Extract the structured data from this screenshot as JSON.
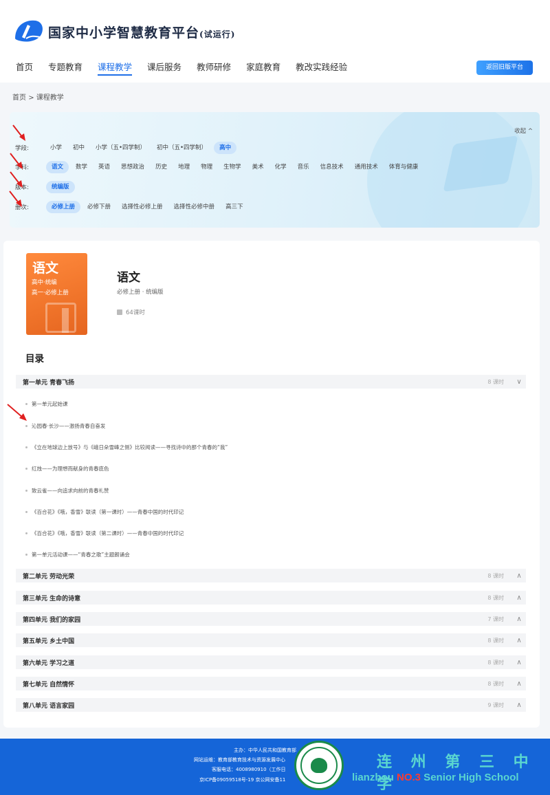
{
  "header": {
    "site_title": "国家中小学智慧教育平台",
    "site_title_suffix": "(试运行)",
    "return_button": "返回旧版平台"
  },
  "nav": {
    "items": [
      "首页",
      "专题教育",
      "课程教学",
      "课后服务",
      "教师研修",
      "家庭教育",
      "教改实践经验"
    ],
    "active": "课程教学"
  },
  "breadcrumb": {
    "home": "首页",
    "sep": ">",
    "current": "课程教学"
  },
  "filter": {
    "collapse": "收起 ^",
    "rows": [
      {
        "label": "学段:",
        "options": [
          "小学",
          "初中",
          "小学（五•四学制）",
          "初中（五•四学制）",
          "高中"
        ],
        "selected": "高中"
      },
      {
        "label": "学科:",
        "options": [
          "语文",
          "数学",
          "英语",
          "思想政治",
          "历史",
          "地理",
          "物理",
          "生物学",
          "美术",
          "化学",
          "音乐",
          "信息技术",
          "通用技术",
          "体育与健康"
        ],
        "selected": "语文"
      },
      {
        "label": "版本:",
        "options": [
          "统编版"
        ],
        "selected": "统编版"
      },
      {
        "label": "册次:",
        "options": [
          "必修上册",
          "必修下册",
          "选择性必修上册",
          "选择性必修中册",
          "高三下"
        ],
        "selected": "必修上册"
      }
    ]
  },
  "book": {
    "cover_title": "语文",
    "cover_line1": "高中·统编",
    "cover_line2": "高一·必修上册",
    "title": "语文",
    "subtitle": "必修上册 · 统编版",
    "hours": "64课时"
  },
  "toc": {
    "title": "目录",
    "first_unit": {
      "title": "第一单元 青春飞扬",
      "hours": "8 课时",
      "icon": "chevron-down"
    },
    "lessons": [
      "第一单元起始课",
      "沁园春·长沙——激扬青春自奋发",
      "《立在地球边上放号》与《峨日朵雪峰之侧》比较阅读——寻找诗中的那个青春的“我”",
      "红烛——为理想而献身的青春底色",
      "致云雀——向追求向前的青春礼赞",
      "《百合花》《哦，香雪》联读（第一课时）——青春中国的时代印记",
      "《百合花》《哦，香雪》联读（第二课时）——青春中国的时代印记",
      "第一单元活动课——“青春之歌”主题朗诵会"
    ],
    "units": [
      {
        "title": "第二单元 劳动光荣",
        "hours": "8 课时"
      },
      {
        "title": "第三单元 生命的诗意",
        "hours": "8 课时"
      },
      {
        "title": "第四单元 我们的家园",
        "hours": "7 课时"
      },
      {
        "title": "第五单元 乡土中国",
        "hours": "8 课时"
      },
      {
        "title": "第六单元 学习之道",
        "hours": "8 课时"
      },
      {
        "title": "第七单元 自然情怀",
        "hours": "8 课时"
      },
      {
        "title": "第八单元 语言家园",
        "hours": "9 课时"
      }
    ]
  },
  "footer": {
    "line1": "主办：中华人民共和国教育部",
    "line2": "网站运维：教育部教育技术与资源发展中心",
    "line3": "客服电话：4008980910（工作日",
    "line4": "京ICP备09059518号-19  京公网安备11",
    "school_cn": "连 州 第 三 中 学",
    "school_en_pre": "lianzhou ",
    "school_en_no": "NO.3",
    "school_en_post": " Senior High School"
  },
  "colors": {
    "accent": "#1e6fe8",
    "footer": "#1565d8",
    "arrow": "#e02020",
    "school": "#5ad6d0"
  }
}
